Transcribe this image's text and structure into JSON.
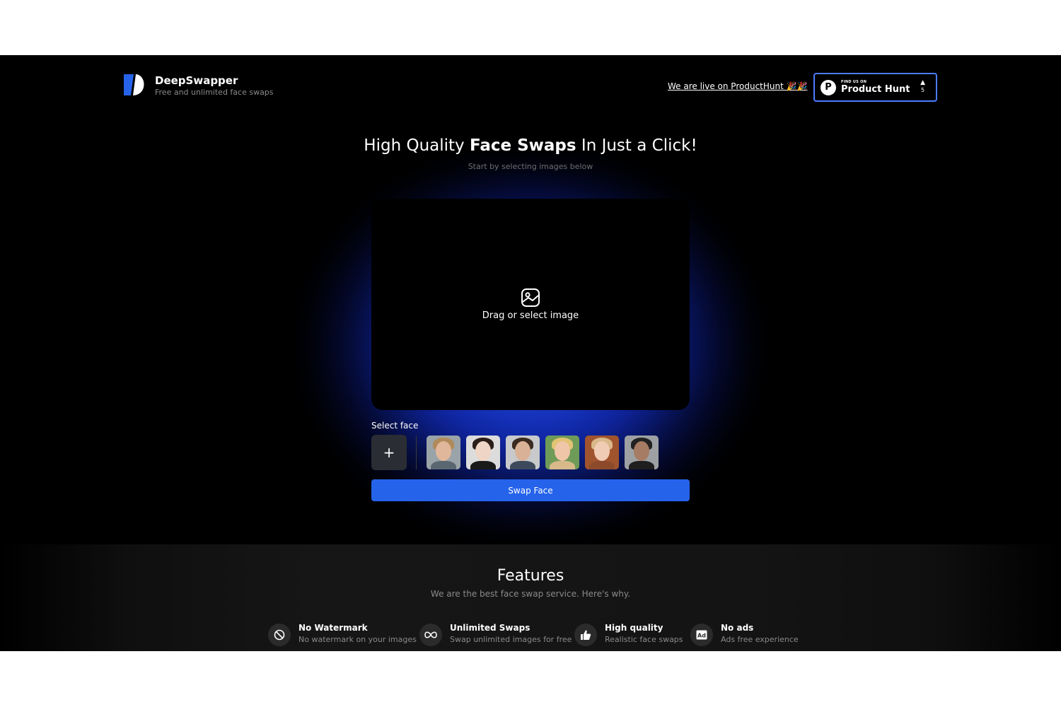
{
  "header": {
    "brand": "DeepSwapper",
    "tagline": "Free and unlimited face swaps",
    "producthunt_link": "We are live on ProductHunt 🎉🎉",
    "ph_badge": {
      "small": "FIND US ON",
      "big": "Product Hunt",
      "logo_letter": "P",
      "arrow": "▲",
      "votes": "5"
    }
  },
  "hero": {
    "title_pre": "High Quality ",
    "title_bold": "Face Swaps",
    "title_post": " In Just a Click!",
    "subtitle": "Start by selecting images below",
    "dropzone_label": "Drag or select image"
  },
  "face_selector": {
    "label": "Select face",
    "add_label": "+",
    "faces": [
      {
        "name": "face-1",
        "bg": "#9aa3a8",
        "skin": "#e1b79b",
        "hair": "#b08a5a",
        "shirt": "#5b6770"
      },
      {
        "name": "face-2",
        "bg": "#dcdcdc",
        "skin": "#efd5c5",
        "hair": "#2b1d18",
        "shirt": "#1a1a1a"
      },
      {
        "name": "face-3",
        "bg": "#c7c9cb",
        "skin": "#d9b196",
        "hair": "#3b2a20",
        "shirt": "#3d4a5c"
      },
      {
        "name": "face-4",
        "bg": "#6f9b58",
        "skin": "#f0c6a8",
        "hair": "#e1c374",
        "shirt": "#d8b98a"
      },
      {
        "name": "face-5",
        "bg": "#a0542d",
        "skin": "#f1ccb5",
        "hair": "#d9b88a",
        "shirt": "#8c4a2a"
      },
      {
        "name": "face-6",
        "bg": "#9da1a3",
        "skin": "#a77c64",
        "hair": "#222222",
        "shirt": "#1f1f1f"
      }
    ]
  },
  "actions": {
    "swap_label": "Swap Face"
  },
  "features": {
    "title": "Features",
    "subtitle": "We are the best face swap service. Here's why.",
    "items": [
      {
        "icon": "no-watermark-icon",
        "glyph": "⃠",
        "name": "No Watermark",
        "desc": "No watermark on your images"
      },
      {
        "icon": "infinity-icon",
        "glyph": "∞",
        "name": "Unlimited Swaps",
        "desc": "Swap unlimited images for free"
      },
      {
        "icon": "thumbs-up-icon",
        "glyph": "👍",
        "name": "High quality",
        "desc": "Realistic face swaps"
      },
      {
        "icon": "ad-icon",
        "glyph": "Ad",
        "name": "No ads",
        "desc": "Ads free experience"
      }
    ]
  },
  "colors": {
    "accent": "#2563eb",
    "glow": "#1f4fff",
    "badge_border": "#4d7cff"
  }
}
